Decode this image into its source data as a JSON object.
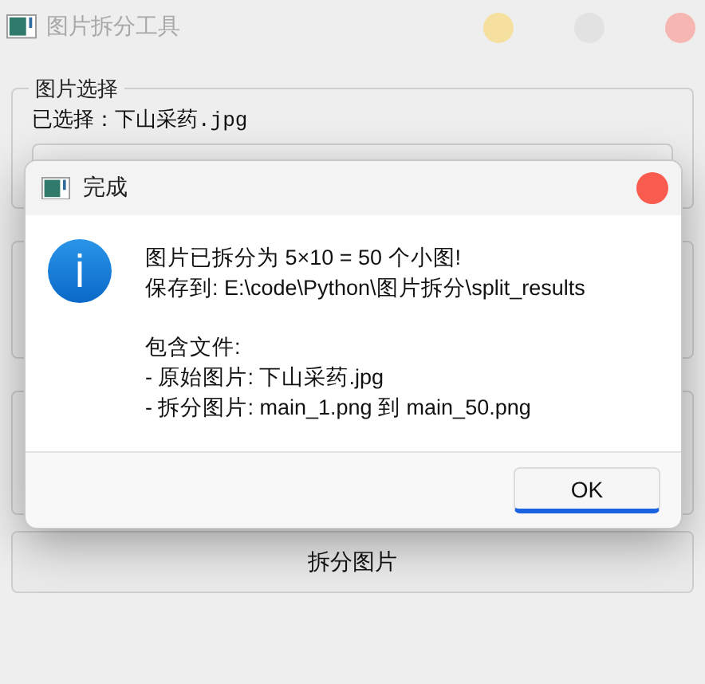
{
  "window": {
    "title": "图片拆分工具"
  },
  "image_group": {
    "title": "图片选择",
    "selected_label": "已选择：下山采药.jpg"
  },
  "split_button": "拆分图片",
  "dialog": {
    "title": "完成",
    "message": [
      [
        "图片已拆分为 5×10 = 50 个小图!",
        "保存到: E:\\code\\Python\\图片拆分\\split_results"
      ],
      [
        "包含文件:",
        "- 原始图片: 下山采药.jpg",
        "- 拆分图片: main_1.png 到 main_50.png"
      ]
    ],
    "ok_button": "OK"
  }
}
